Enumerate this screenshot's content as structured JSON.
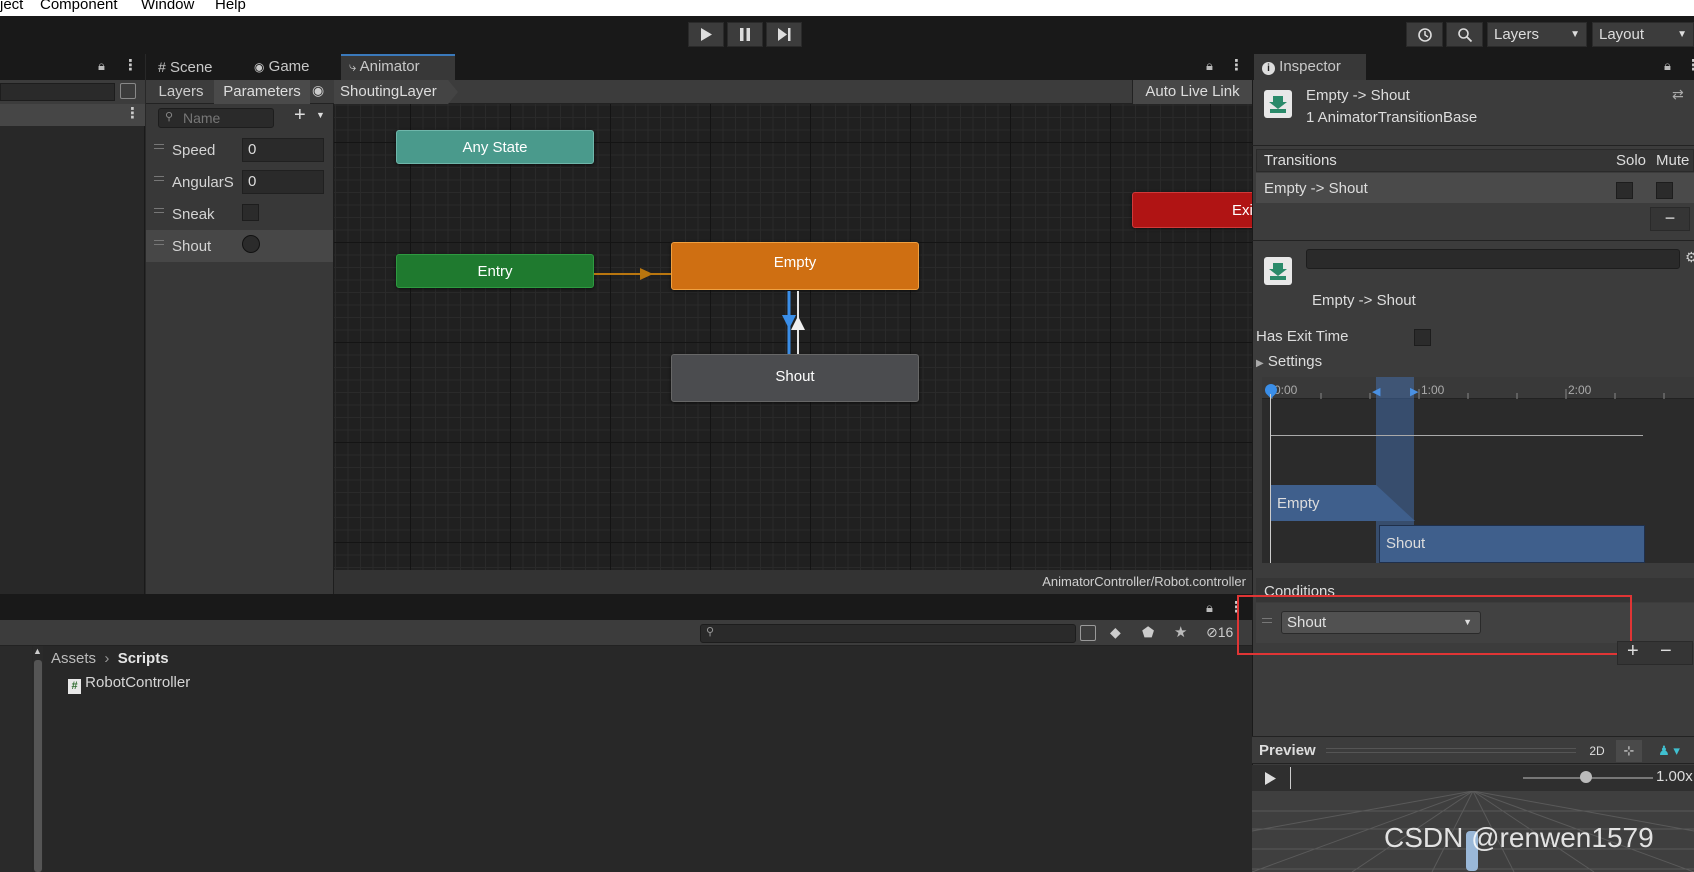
{
  "menu": {
    "items": [
      "ject",
      "Component",
      "Window",
      "Help"
    ]
  },
  "toolbar": {
    "play_icon": "play-icon",
    "pause_icon": "pause-icon",
    "step_icon": "step-icon",
    "layers_label": "Layers",
    "layout_label": "Layout"
  },
  "tabs": {
    "scene": "Scene",
    "game": "Game",
    "animator": "Animator",
    "inspector": "Inspector"
  },
  "animator": {
    "subtabs": {
      "layers": "Layers",
      "parameters": "Parameters"
    },
    "breadcrumb": "ShoutingLayer",
    "auto_live_link": "Auto Live Link",
    "search_placeholder": "Name",
    "parameters": [
      {
        "name": "Speed",
        "type": "float",
        "value": "0"
      },
      {
        "name": "AngularS",
        "type": "float",
        "value": "0"
      },
      {
        "name": "Sneak",
        "type": "bool"
      },
      {
        "name": "Shout",
        "type": "trigger"
      }
    ],
    "nodes": {
      "any_state": "Any State",
      "entry": "Entry",
      "empty": "Empty",
      "shout": "Shout",
      "exit": "Exit"
    },
    "footer_path": "AnimatorController/Robot.controller",
    "colors": {
      "any_state": "#4a9a8c",
      "entry": "#1f7a2f",
      "empty": "#cf6f12",
      "shout": "#4b4c4f",
      "exit": "#b01414"
    }
  },
  "project": {
    "breadcrumb_root": "Assets",
    "breadcrumb_current": "Scripts",
    "files": [
      "RobotController"
    ],
    "hidden_count": "16"
  },
  "inspector": {
    "title": "Empty -> Shout",
    "subtitle": "1 AnimatorTransitionBase",
    "transitions_header": "Transitions",
    "solo_label": "Solo",
    "mute_label": "Mute",
    "transition_row": "Empty -> Shout",
    "transition_name": "Empty -> Shout",
    "has_exit_time_label": "Has Exit Time",
    "settings_label": "Settings",
    "timeline_ticks": [
      "0:00",
      "1:00",
      "2:00"
    ],
    "timeline_clips": [
      "Empty",
      "Shout"
    ],
    "conditions_header": "Conditions",
    "condition_value": "Shout",
    "preview_label": "Preview",
    "preview_2d": "2D",
    "preview_speed": "1.00x"
  },
  "watermark": "CSDN @renwen1579"
}
